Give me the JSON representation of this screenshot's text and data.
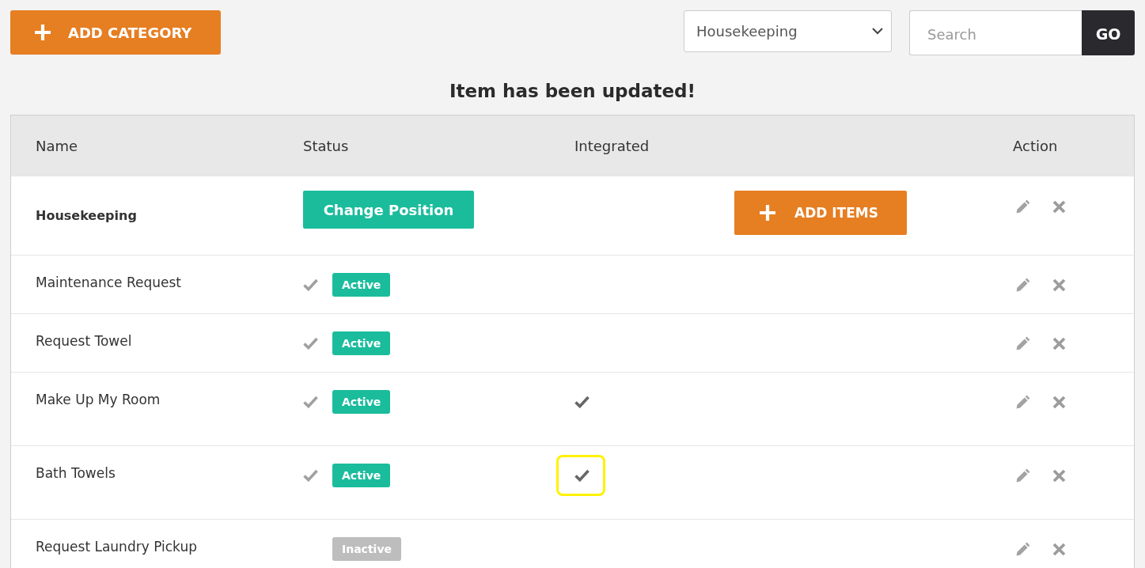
{
  "toolbar": {
    "add_button": "ADD CATEGORY",
    "category_select": "Housekeeping",
    "search": {
      "placeholder": "Search"
    },
    "go_button": "GO"
  },
  "message": "Item has been updated!",
  "table": {
    "columns": [
      "Name",
      "Status",
      "Integrated",
      "Action"
    ],
    "category": {
      "name": "Housekeeping",
      "position_button": "Change Position",
      "add_items_button": "ADD ITEMS"
    },
    "rows": [
      {
        "name": "Maintenance Request",
        "checked": true,
        "badge": "Active",
        "active": true,
        "integrated": false,
        "highlighted": false
      },
      {
        "name": "Request Towel",
        "checked": true,
        "badge": "Active",
        "active": true,
        "integrated": false,
        "highlighted": false
      },
      {
        "name": "Make Up My Room",
        "checked": true,
        "badge": "Active",
        "active": true,
        "integrated": true,
        "highlighted": false
      },
      {
        "name": "Bath Towels",
        "checked": true,
        "badge": "Active",
        "active": true,
        "integrated": true,
        "highlighted": true
      },
      {
        "name": "Request Laundry Pickup",
        "checked": false,
        "badge": "Inactive",
        "active": false,
        "integrated": false,
        "highlighted": false
      }
    ]
  }
}
